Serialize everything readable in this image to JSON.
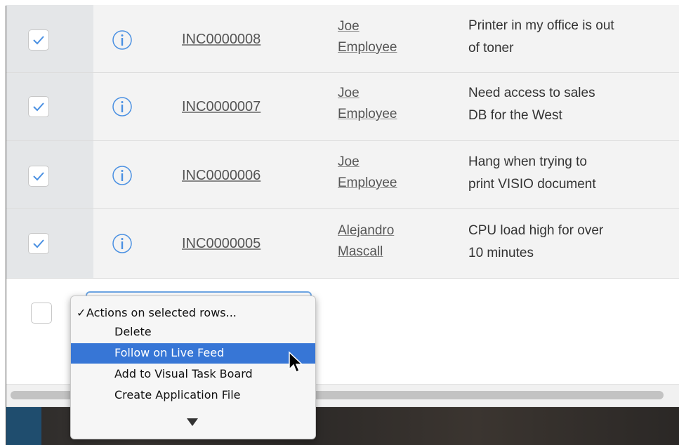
{
  "rows": [
    {
      "number": "INC0000008",
      "caller_first": "Joe",
      "caller_last": "Employee",
      "desc_line1": "Printer in my office is out",
      "desc_line2": "of toner"
    },
    {
      "number": "INC0000007",
      "caller_first": "Joe",
      "caller_last": "Employee",
      "desc_line1": "Need access to sales",
      "desc_line2": "DB for the West"
    },
    {
      "number": "INC0000006",
      "caller_first": "Joe",
      "caller_last": "Employee",
      "desc_line1": "Hang when trying to",
      "desc_line2": "print VISIO document"
    },
    {
      "number": "INC0000005",
      "caller_first": "Alejandro",
      "caller_last": "Mascall",
      "desc_line1": "CPU load high for over",
      "desc_line2": "10 minutes"
    }
  ],
  "menu": {
    "check_mark": "✓",
    "title": "Actions on selected rows...",
    "items": [
      "Delete",
      "Follow on Live Feed",
      "Add to Visual Task Board",
      "Create Application File"
    ],
    "selected_index": 1
  },
  "colors": {
    "accent": "#3776d6",
    "check_blue": "#4a90e2",
    "info_blue": "#4a90e2",
    "row_bg": "#f3f3f3",
    "checkbox_col_bg": "#e4e6e8"
  },
  "icons": {
    "row_checkbox": "checked-checkbox-icon",
    "row_info": "info-circle-icon",
    "menu_scroll": "chevron-down-icon",
    "pointer": "mouse-pointer-icon"
  }
}
